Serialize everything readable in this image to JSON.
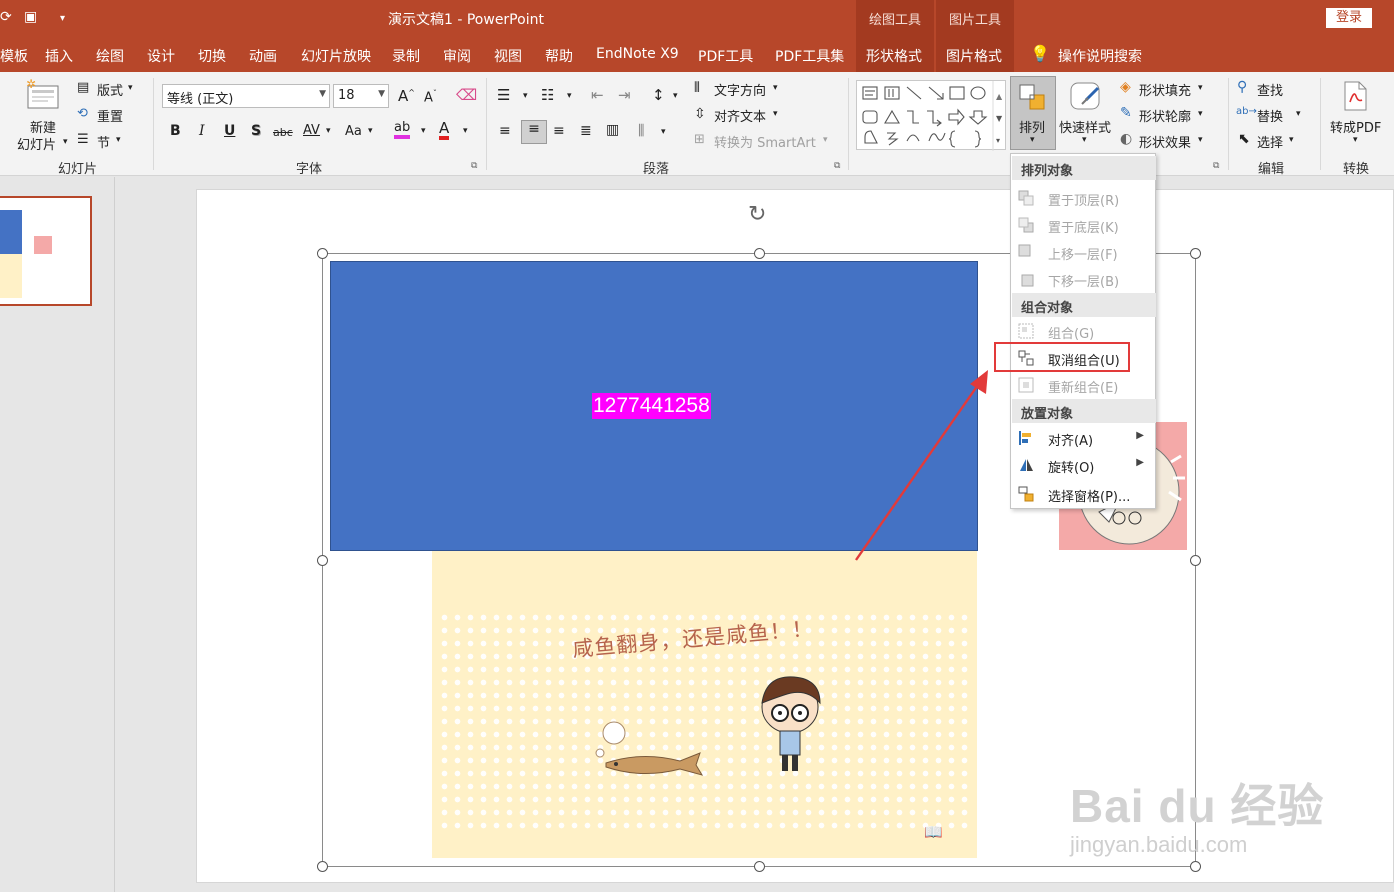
{
  "titlebar": {
    "title": "演示文稿1  -  PowerPoint",
    "context_tab_drawing": "绘图工具",
    "context_tab_picture": "图片工具",
    "login": "登录"
  },
  "menu": {
    "items": [
      "模板",
      "插入",
      "绘图",
      "设计",
      "切换",
      "动画",
      "幻灯片放映",
      "录制",
      "审阅",
      "视图",
      "帮助",
      "EndNote X9",
      "PDF工具",
      "PDF工具集",
      "形状格式",
      "图片格式"
    ],
    "search": "操作说明搜索"
  },
  "ribbon": {
    "slides": {
      "new_slide_line1": "新建",
      "new_slide_line2": "幻灯片",
      "layout": "版式",
      "reset": "重置",
      "section": "节",
      "label": "幻灯片"
    },
    "font": {
      "font_name": "等线 (正文)",
      "font_size": "18",
      "bold": "B",
      "italic": "I",
      "underline": "U",
      "shadow": "S",
      "strike": "abc",
      "spacing": "AV",
      "case": "Aa",
      "label": "字体"
    },
    "paragraph": {
      "text_direction": "文字方向",
      "align_text": "对齐文本",
      "smartart": "转换为 SmartArt",
      "label": "段落"
    },
    "drawing": {
      "arrange": "排列",
      "quick_styles": "快速样式",
      "shape_fill": "形状填充",
      "shape_outline": "形状轮廓",
      "shape_effects": "形状效果"
    },
    "editing": {
      "find": "查找",
      "replace": "替换",
      "select": "选择",
      "label": "编辑"
    },
    "convert": {
      "to_pdf": "转成PDF",
      "label": "转换"
    }
  },
  "slide": {
    "phone_text": "1277441258",
    "slogan": "咸鱼翻身，还是咸鱼！！",
    "colors": {
      "blue_rect": "#4472c4",
      "highlight": "#ff00ff",
      "accent": "#b7472a"
    }
  },
  "dropdown": {
    "header_order": "排列对象",
    "bring_front": "置于顶层(R)",
    "send_back": "置于底层(K)",
    "bring_forward": "上移一层(F)",
    "send_backward": "下移一层(B)",
    "header_group": "组合对象",
    "group": "组合(G)",
    "ungroup": "取消组合(U)",
    "regroup": "重新组合(E)",
    "header_position": "放置对象",
    "align": "对齐(A)",
    "rotate": "旋转(O)",
    "selection_pane": "选择窗格(P)..."
  },
  "watermark": {
    "brand": "Bai du 经验",
    "url": "jingyan.baidu.com"
  }
}
